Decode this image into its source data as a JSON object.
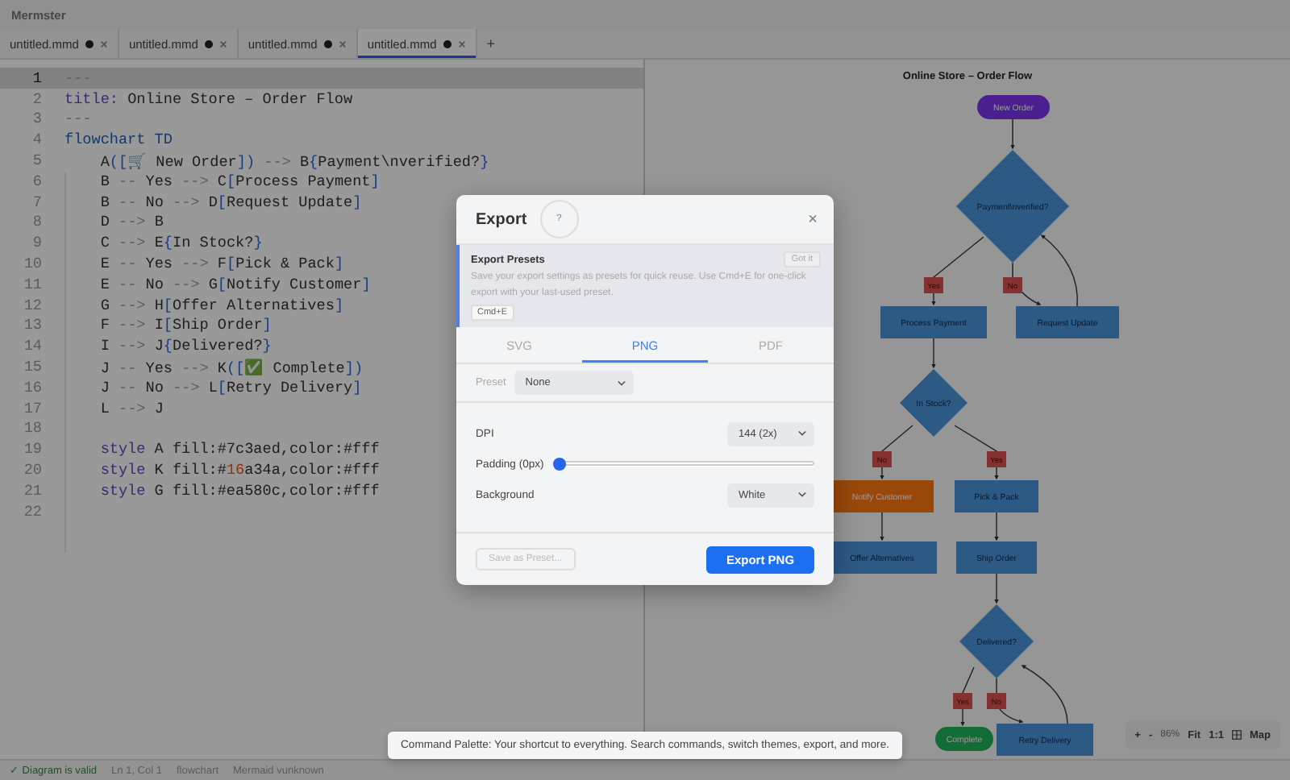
{
  "window": {
    "title": "Mermster"
  },
  "tabs": [
    {
      "label": "untitled.mmd",
      "modified": true,
      "selected": false
    },
    {
      "label": "untitled.mmd",
      "modified": true,
      "selected": false
    },
    {
      "label": "untitled.mmd",
      "modified": true,
      "selected": false
    },
    {
      "label": "untitled.mmd",
      "modified": true,
      "selected": true
    }
  ],
  "new_tab": "+",
  "editor": {
    "lines": [
      {
        "number": "1",
        "current": true,
        "tokens": [
          {
            "kind": "op",
            "text": "---"
          }
        ]
      },
      {
        "number": "2",
        "current": false,
        "tokens": [
          {
            "kind": "key",
            "text": "title:"
          },
          {
            "kind": "tx",
            "text": " Online Store – Order Flow"
          }
        ]
      },
      {
        "number": "3",
        "current": false,
        "tokens": [
          {
            "kind": "op",
            "text": "---"
          }
        ]
      },
      {
        "number": "4",
        "current": false,
        "tokens": [
          {
            "kind": "kw",
            "text": "flowchart TD"
          }
        ]
      },
      {
        "number": "5",
        "current": false,
        "tokens": [
          {
            "kind": "tx",
            "text": "    A"
          },
          {
            "kind": "br",
            "text": "(["
          },
          {
            "kind": "tx",
            "text": "🛒 New Order"
          },
          {
            "kind": "br",
            "text": "])"
          },
          {
            "kind": "op",
            "text": " --> "
          },
          {
            "kind": "tx",
            "text": "B"
          },
          {
            "kind": "br",
            "text": "{"
          },
          {
            "kind": "tx",
            "text": "Payment\\nverified?"
          },
          {
            "kind": "br",
            "text": "}"
          }
        ]
      },
      {
        "number": "6",
        "current": false,
        "tokens": [
          {
            "kind": "tx",
            "text": "    B "
          },
          {
            "kind": "op",
            "text": "--"
          },
          {
            "kind": "tx",
            "text": " Yes "
          },
          {
            "kind": "op",
            "text": "-->"
          },
          {
            "kind": "tx",
            "text": " C"
          },
          {
            "kind": "br",
            "text": "["
          },
          {
            "kind": "tx",
            "text": "Process Payment"
          },
          {
            "kind": "br",
            "text": "]"
          }
        ]
      },
      {
        "number": "7",
        "current": false,
        "tokens": [
          {
            "kind": "tx",
            "text": "    B "
          },
          {
            "kind": "op",
            "text": "--"
          },
          {
            "kind": "tx",
            "text": " No "
          },
          {
            "kind": "op",
            "text": "-->"
          },
          {
            "kind": "tx",
            "text": " D"
          },
          {
            "kind": "br",
            "text": "["
          },
          {
            "kind": "tx",
            "text": "Request Update"
          },
          {
            "kind": "br",
            "text": "]"
          }
        ]
      },
      {
        "number": "8",
        "current": false,
        "tokens": [
          {
            "kind": "tx",
            "text": "    D "
          },
          {
            "kind": "op",
            "text": "-->"
          },
          {
            "kind": "tx",
            "text": " B"
          }
        ]
      },
      {
        "number": "9",
        "current": false,
        "tokens": [
          {
            "kind": "tx",
            "text": "    C "
          },
          {
            "kind": "op",
            "text": "-->"
          },
          {
            "kind": "tx",
            "text": " E"
          },
          {
            "kind": "br",
            "text": "{"
          },
          {
            "kind": "tx",
            "text": "In Stock?"
          },
          {
            "kind": "br",
            "text": "}"
          }
        ]
      },
      {
        "number": "10",
        "current": false,
        "tokens": [
          {
            "kind": "tx",
            "text": "    E "
          },
          {
            "kind": "op",
            "text": "--"
          },
          {
            "kind": "tx",
            "text": " Yes "
          },
          {
            "kind": "op",
            "text": "-->"
          },
          {
            "kind": "tx",
            "text": " F"
          },
          {
            "kind": "br",
            "text": "["
          },
          {
            "kind": "tx",
            "text": "Pick & Pack"
          },
          {
            "kind": "br",
            "text": "]"
          }
        ]
      },
      {
        "number": "11",
        "current": false,
        "tokens": [
          {
            "kind": "tx",
            "text": "    E "
          },
          {
            "kind": "op",
            "text": "--"
          },
          {
            "kind": "tx",
            "text": " No "
          },
          {
            "kind": "op",
            "text": "-->"
          },
          {
            "kind": "tx",
            "text": " G"
          },
          {
            "kind": "br",
            "text": "["
          },
          {
            "kind": "tx",
            "text": "Notify Customer"
          },
          {
            "kind": "br",
            "text": "]"
          }
        ]
      },
      {
        "number": "12",
        "current": false,
        "tokens": [
          {
            "kind": "tx",
            "text": "    G "
          },
          {
            "kind": "op",
            "text": "-->"
          },
          {
            "kind": "tx",
            "text": " H"
          },
          {
            "kind": "br",
            "text": "["
          },
          {
            "kind": "tx",
            "text": "Offer Alternatives"
          },
          {
            "kind": "br",
            "text": "]"
          }
        ]
      },
      {
        "number": "13",
        "current": false,
        "tokens": [
          {
            "kind": "tx",
            "text": "    F "
          },
          {
            "kind": "op",
            "text": "-->"
          },
          {
            "kind": "tx",
            "text": " I"
          },
          {
            "kind": "br",
            "text": "["
          },
          {
            "kind": "tx",
            "text": "Ship Order"
          },
          {
            "kind": "br",
            "text": "]"
          }
        ]
      },
      {
        "number": "14",
        "current": false,
        "tokens": [
          {
            "kind": "tx",
            "text": "    I "
          },
          {
            "kind": "op",
            "text": "-->"
          },
          {
            "kind": "tx",
            "text": " J"
          },
          {
            "kind": "br",
            "text": "{"
          },
          {
            "kind": "tx",
            "text": "Delivered?"
          },
          {
            "kind": "br",
            "text": "}"
          }
        ]
      },
      {
        "number": "15",
        "current": false,
        "tokens": [
          {
            "kind": "tx",
            "text": "    J "
          },
          {
            "kind": "op",
            "text": "--"
          },
          {
            "kind": "tx",
            "text": " Yes "
          },
          {
            "kind": "op",
            "text": "-->"
          },
          {
            "kind": "tx",
            "text": " K"
          },
          {
            "kind": "br",
            "text": "(["
          },
          {
            "kind": "tx",
            "text": "✅ Complete"
          },
          {
            "kind": "br",
            "text": "])"
          }
        ]
      },
      {
        "number": "16",
        "current": false,
        "tokens": [
          {
            "kind": "tx",
            "text": "    J "
          },
          {
            "kind": "op",
            "text": "--"
          },
          {
            "kind": "tx",
            "text": " No "
          },
          {
            "kind": "op",
            "text": "-->"
          },
          {
            "kind": "tx",
            "text": " L"
          },
          {
            "kind": "br",
            "text": "["
          },
          {
            "kind": "tx",
            "text": "Retry Delivery"
          },
          {
            "kind": "br",
            "text": "]"
          }
        ]
      },
      {
        "number": "17",
        "current": false,
        "tokens": [
          {
            "kind": "tx",
            "text": "    L "
          },
          {
            "kind": "op",
            "text": "-->"
          },
          {
            "kind": "tx",
            "text": " J"
          }
        ]
      },
      {
        "number": "18",
        "current": false
      },
      {
        "number": "19",
        "current": false,
        "tokens": [
          {
            "kind": "key",
            "text": "    style"
          },
          {
            "kind": "tx",
            "text": " A fill:#7c3aed,color:#fff"
          }
        ]
      },
      {
        "number": "20",
        "current": false,
        "tokens": [
          {
            "kind": "key",
            "text": "    style"
          },
          {
            "kind": "tx",
            "text": " K fill:#"
          },
          {
            "kind": "num",
            "text": "16"
          },
          {
            "kind": "tx",
            "text": "a34a,color:#fff"
          }
        ]
      },
      {
        "number": "21",
        "current": false,
        "tokens": [
          {
            "kind": "key",
            "text": "    style"
          },
          {
            "kind": "tx",
            "text": " G fill:#ea580c,color:#fff"
          }
        ]
      },
      {
        "number": "22",
        "current": false
      }
    ]
  },
  "preview": {
    "diagram": {
      "title": "Online Store – Order Flow",
      "nodes": [
        {
          "label": "New Order",
          "kind": "pill",
          "color": "#4c2090",
          "styled": true
        },
        {
          "label": "Payment\\nverified?",
          "kind": "diamond",
          "color": "#2d5a85",
          "styled": false
        },
        {
          "label": "Process Payment",
          "kind": "rect",
          "color": "#2d5a85",
          "styled": false
        },
        {
          "label": "Request Update",
          "kind": "rect",
          "color": "#2d5a85",
          "styled": false
        },
        {
          "label": "In Stock?",
          "kind": "diamond",
          "color": "#2d5a85",
          "styled": false
        },
        {
          "label": "Notify Customer",
          "kind": "rect",
          "color": "#99480a",
          "styled": true
        },
        {
          "label": "Pick & Pack",
          "kind": "rect",
          "color": "#2d5a85",
          "styled": false
        },
        {
          "label": "Offer Alternatives",
          "kind": "rect",
          "color": "#2d5a85",
          "styled": false
        },
        {
          "label": "Ship Order",
          "kind": "rect",
          "color": "#2d5a85",
          "styled": false
        },
        {
          "label": "Delivered?",
          "kind": "diamond",
          "color": "#2d5a85",
          "styled": false
        },
        {
          "label": "Complete",
          "kind": "pill",
          "color": "#146c36",
          "styled": true
        },
        {
          "label": "Retry Delivery",
          "kind": "rect",
          "color": "#2d5a85",
          "styled": false
        }
      ],
      "edge_labels": [
        "Yes",
        "No",
        "No",
        "Yes",
        "Yes",
        "No"
      ]
    },
    "zoom_controls": {
      "zoom_in": "+",
      "zoom_out": "-",
      "zoom_level": "86%",
      "fit": "Fit",
      "actual_size": "1:1",
      "map": "Map"
    }
  },
  "status_bar": {
    "validity": "✓ Diagram is valid",
    "position": "Ln 1, Col 1",
    "diagram_type": "flowchart",
    "version": "Mermaid vunknown"
  },
  "export_dialog": {
    "title": "Export",
    "help": "?",
    "close": "×",
    "presets_banner": {
      "title": "Export Presets",
      "text": "Save your export settings as presets for quick reuse. Use Cmd+E for one-click export with your last-used preset.",
      "shortcut": "Cmd+E",
      "dismiss": "Got it"
    },
    "tabs": [
      {
        "label": "SVG",
        "selected": false
      },
      {
        "label": "PNG",
        "selected": true
      },
      {
        "label": "PDF",
        "selected": false
      }
    ],
    "preset": {
      "label": "Preset",
      "value": "None"
    },
    "dpi": {
      "label": "DPI",
      "value": "144 (2x)"
    },
    "padding": {
      "label": "Padding (0px)",
      "level": 0
    },
    "background": {
      "label": "Background",
      "value": "White"
    },
    "save_preset": {
      "label": "Save as Preset...",
      "disabled": true
    },
    "export_button": "Export PNG"
  },
  "toast": {
    "text": "Command Palette: Your shortcut to everything. Search commands, switch themes, export, and more."
  }
}
